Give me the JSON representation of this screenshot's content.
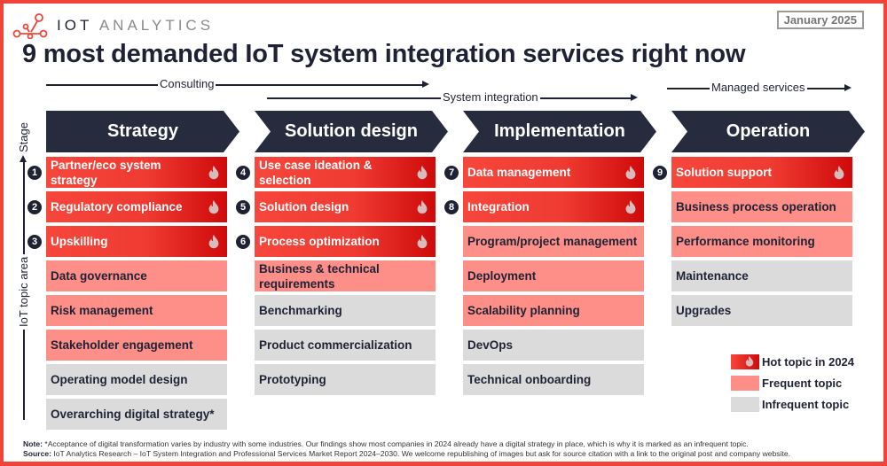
{
  "brand": {
    "logo_text_bold": "IOT",
    "logo_text_light": "ANALYTICS",
    "accent_color": "#f04438"
  },
  "date_badge": "January 2025",
  "title": "9 most demanded IoT system integration services right now",
  "phases": [
    {
      "label": "Consulting"
    },
    {
      "label": "System integration"
    },
    {
      "label": "Managed services"
    }
  ],
  "axis": {
    "stage_label": "Stage",
    "topic_label": "IoT topic area"
  },
  "stages": [
    {
      "label": "Strategy",
      "items": [
        {
          "number": "1",
          "text": "Partner/eco system strategy",
          "level": "hot"
        },
        {
          "number": "2",
          "text": "Regulatory compliance",
          "level": "hot"
        },
        {
          "number": "3",
          "text": "Upskilling",
          "level": "hot"
        },
        {
          "number": "",
          "text": "Data governance",
          "level": "frequent"
        },
        {
          "number": "",
          "text": "Risk management",
          "level": "frequent"
        },
        {
          "number": "",
          "text": "Stakeholder engagement",
          "level": "frequent"
        },
        {
          "number": "",
          "text": "Operating model design",
          "level": "infrequent"
        },
        {
          "number": "",
          "text": "Overarching digital strategy*",
          "level": "infrequent"
        }
      ]
    },
    {
      "label": "Solution design",
      "items": [
        {
          "number": "4",
          "text": "Use case ideation & selection",
          "level": "hot"
        },
        {
          "number": "5",
          "text": "Solution design",
          "level": "hot"
        },
        {
          "number": "6",
          "text": "Process optimization",
          "level": "hot"
        },
        {
          "number": "",
          "text": "Business & technical requirements",
          "level": "frequent"
        },
        {
          "number": "",
          "text": "Benchmarking",
          "level": "infrequent"
        },
        {
          "number": "",
          "text": "Product commercialization",
          "level": "infrequent"
        },
        {
          "number": "",
          "text": "Prototyping",
          "level": "infrequent"
        }
      ]
    },
    {
      "label": "Implementation",
      "items": [
        {
          "number": "7",
          "text": "Data management",
          "level": "hot"
        },
        {
          "number": "8",
          "text": "Integration",
          "level": "hot"
        },
        {
          "number": "",
          "text": "Program/project management",
          "level": "frequent"
        },
        {
          "number": "",
          "text": "Deployment",
          "level": "frequent"
        },
        {
          "number": "",
          "text": "Scalability planning",
          "level": "frequent"
        },
        {
          "number": "",
          "text": "DevOps",
          "level": "infrequent"
        },
        {
          "number": "",
          "text": "Technical onboarding",
          "level": "infrequent"
        }
      ]
    },
    {
      "label": "Operation",
      "items": [
        {
          "number": "9",
          "text": "Solution support",
          "level": "hot"
        },
        {
          "number": "",
          "text": "Business process operation",
          "level": "frequent"
        },
        {
          "number": "",
          "text": "Performance monitoring",
          "level": "frequent"
        },
        {
          "number": "",
          "text": "Maintenance",
          "level": "infrequent"
        },
        {
          "number": "",
          "text": "Upgrades",
          "level": "infrequent"
        }
      ]
    }
  ],
  "legend": [
    {
      "level": "hot",
      "label": "Hot topic in 2024",
      "icon": "flame-icon"
    },
    {
      "level": "frequent",
      "label": "Frequent topic"
    },
    {
      "level": "infrequent",
      "label": "Infrequent topic"
    }
  ],
  "colors": {
    "hot": "#ef3b32",
    "frequent": "#fd8e88",
    "infrequent": "#dbdbdb",
    "stage": "#262b3e"
  },
  "footer": {
    "note_label": "Note:",
    "note_text": " *Acceptance of digital transformation varies by industry with some industries. Our findings show most companies in 2024 already have a digital strategy in place, which is why it is marked as an infrequent topic.",
    "source_label": "Source:",
    "source_text": " IoT Analytics Research – IoT System Integration and Professional Services Market Report 2024–2030. We welcome republishing of images but ask for source citation with a link to the original post and company website."
  }
}
